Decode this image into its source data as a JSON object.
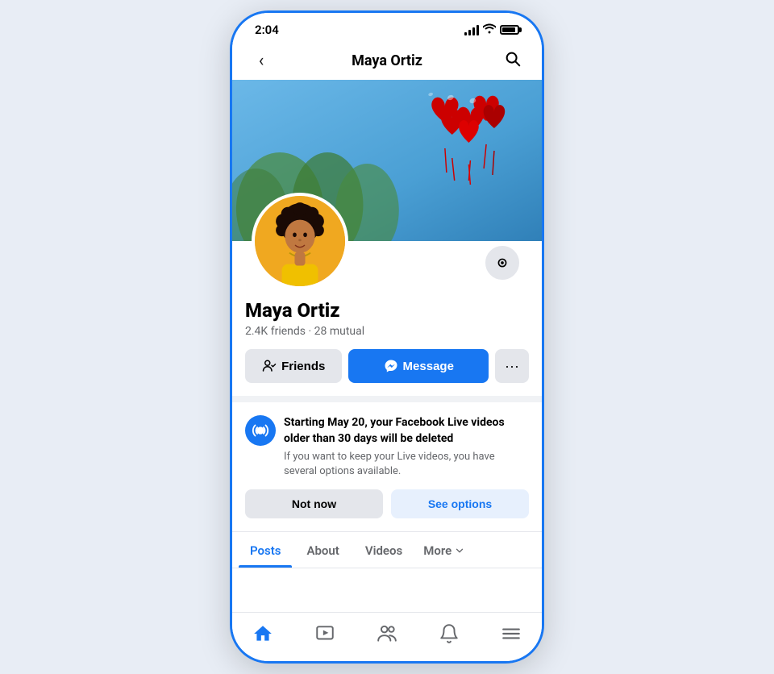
{
  "status": {
    "time": "2:04",
    "carrier_signal": "signal",
    "wifi": "wifi",
    "battery": "battery"
  },
  "nav": {
    "back_label": "‹",
    "title": "Maya Ortiz",
    "search_label": "🔍"
  },
  "profile": {
    "name": "Maya Ortiz",
    "friends_count": "2.4K",
    "friends_label": "friends",
    "mutual_count": "28",
    "mutual_label": "mutual",
    "btn_friends": "Friends",
    "btn_message": "Message",
    "btn_more": "···"
  },
  "notification": {
    "title": "Starting May 20, your Facebook Live videos older than 30 days will be deleted",
    "body": "If you want to keep your Live videos, you have several options available.",
    "btn_not_now": "Not now",
    "btn_see_options": "See options"
  },
  "tabs": [
    {
      "id": "posts",
      "label": "Posts",
      "active": true
    },
    {
      "id": "about",
      "label": "About",
      "active": false
    },
    {
      "id": "videos",
      "label": "Videos",
      "active": false
    },
    {
      "id": "more",
      "label": "More",
      "active": false
    }
  ],
  "bottom_nav": [
    {
      "id": "home",
      "label": "Home",
      "active": true
    },
    {
      "id": "watch",
      "label": "Watch",
      "active": false
    },
    {
      "id": "profile",
      "label": "Profile",
      "active": false
    },
    {
      "id": "notifications",
      "label": "Notifications",
      "active": false
    },
    {
      "id": "menu",
      "label": "Menu",
      "active": false
    }
  ]
}
